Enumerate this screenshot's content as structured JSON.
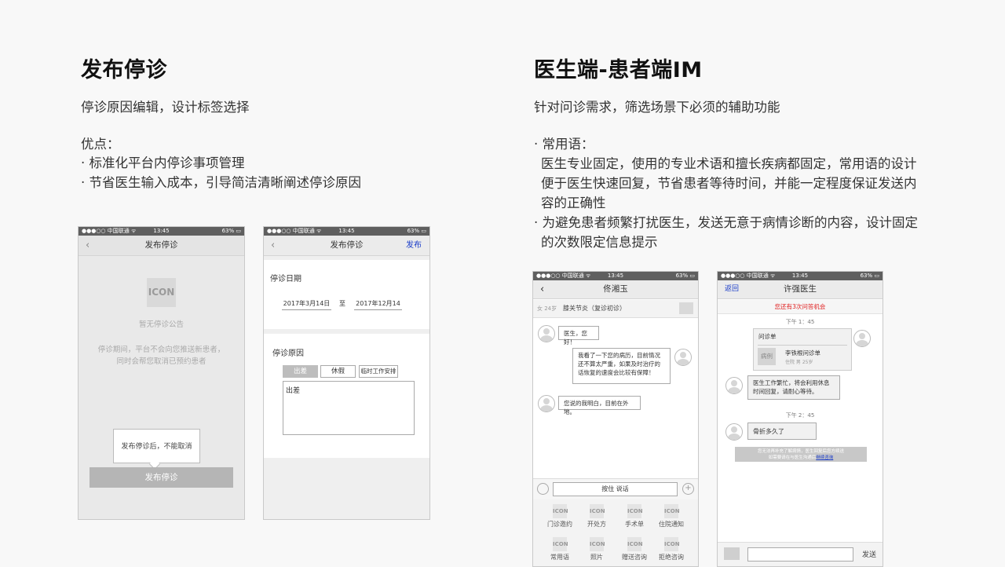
{
  "left": {
    "title": "发布停诊",
    "subtitle": "停诊原因编辑，设计标签选择",
    "adv_title": "优点：",
    "adv_items": [
      "· 标准化平台内停诊事项管理",
      "· 节省医生输入成本，引导简洁清晰阐述停诊原因"
    ]
  },
  "right": {
    "title": "医生端-患者端IM",
    "subtitle": "针对问诊需求，筛选场景下必须的辅助功能",
    "b1": "· 常用语：",
    "b1_l1": "医生专业固定，使用的专业术语和擅长疾病都固定，常用语的设计",
    "b1_l2": "便于医生快速回复，节省患者等待时间，并能一定程度保证发送内",
    "b1_l3": "容的正确性",
    "b2_l1": "· 为避免患者频繁打扰医生，发送无意于病情诊断的内容，设计固定",
    "b2_l2": "的次数限定信息提示"
  },
  "status": {
    "carrier": "●●●○○ 中国联通 ᯤ",
    "time": "13:45",
    "battery": "63% ▭"
  },
  "p1": {
    "back": "‹",
    "title": "发布停诊",
    "icon": "ICON",
    "empty": "暂无停诊公告",
    "desc1": "停诊期间，平台不会向您推送新患者，",
    "desc2": "同时会帮您取消已预约患者",
    "tip": "发布停诊后，不能取消",
    "button": "发布停诊"
  },
  "p2": {
    "back": "‹",
    "title": "发布停诊",
    "publish": "发布",
    "date_label": "停诊日期",
    "start": "2017年3月14日",
    "to": "至",
    "end": "2017年12月14",
    "reason_label": "停诊原因",
    "tags": [
      "出差",
      "休假",
      "临时工作安排"
    ],
    "reason_text": "出差"
  },
  "p3": {
    "back": "‹",
    "title": "佟湘玉",
    "patient_gender": "女 24岁",
    "patient_diag": "膝关节炎（复诊初诊）",
    "m1": "医生，您好！",
    "m2": "我看了一下您的病历，目前情况还不算太严重，如果及时治疗的话恢复的速度会比较有保障！",
    "m3": "您说的我明白，目前在外地。",
    "voice_btn": "按住 说话",
    "grid_icon": "ICON",
    "grid": [
      "门诊邀约",
      "开处方",
      "手术单",
      "住院通知",
      "常用语",
      "照片",
      "赠送咨询",
      "拒绝咨询"
    ]
  },
  "p4": {
    "back": "返回",
    "title": "许强医生",
    "remain": "您还有3次问答机会",
    "t1": "下午 1：45",
    "card_title": "问诊单",
    "card_tag": "病例",
    "card_name": "李铁根问诊单",
    "card_sub": "住院  男  25岁",
    "reply": "医生工作繁忙，将会利用休息时间回复，请耐心等待。",
    "t2": "下午 2：45",
    "m1": "骨折多久了",
    "notice1": "您无法再补充了解病情，医生回复后您方续送",
    "notice2": "如需要请在与医生沟通后",
    "notice_link": "继续咨询",
    "send": "发送"
  }
}
